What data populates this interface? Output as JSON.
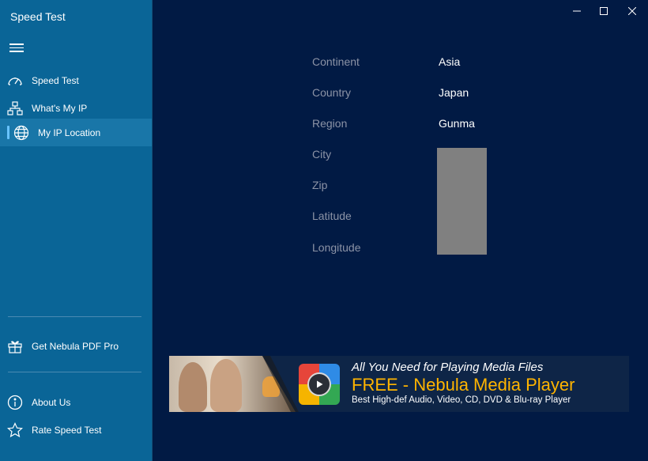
{
  "app": {
    "title": "Speed Test"
  },
  "sidebar": {
    "items": [
      {
        "label": "Speed Test",
        "icon": "speedometer-icon"
      },
      {
        "label": "What's My IP",
        "icon": "network-icon"
      },
      {
        "label": "My IP Location",
        "icon": "globe-icon",
        "active": true
      }
    ],
    "bottom_items": [
      {
        "label": "Get Nebula PDF Pro",
        "icon": "gift-icon"
      },
      {
        "label": "About Us",
        "icon": "info-icon"
      },
      {
        "label": "Rate Speed Test",
        "icon": "star-icon"
      }
    ]
  },
  "location": {
    "rows": [
      {
        "label": "Continent",
        "value": "Asia"
      },
      {
        "label": "Country",
        "value": "Japan"
      },
      {
        "label": "Region",
        "value": "Gunma"
      },
      {
        "label": "City",
        "value": ""
      },
      {
        "label": "Zip",
        "value": ""
      },
      {
        "label": "Latitude",
        "value": ""
      },
      {
        "label": "Longitude",
        "value": ""
      }
    ]
  },
  "banner": {
    "line1": "All You Need for Playing Media Files",
    "line2": "FREE - Nebula Media Player",
    "line3": "Best High-def Audio, Video, CD, DVD & Blu-ray Player"
  },
  "colors": {
    "sidebar_bg": "#0a6597",
    "main_bg": "#011a44",
    "accent": "#69c3ff",
    "banner_highlight": "#ffb400"
  }
}
